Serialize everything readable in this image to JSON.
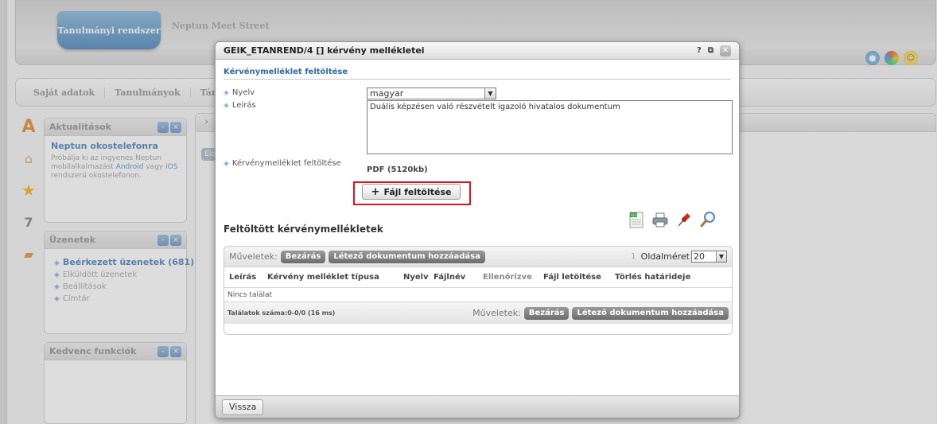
{
  "app": {
    "brand": "Tanulmányi rendszer",
    "subtitle": "Neptun Meet Street",
    "menu": [
      "Saját adatok",
      "Tanulmányok",
      "Tárgy"
    ],
    "panels": {
      "news": {
        "title": "Aktualitások",
        "item_title": "Neptun okostelefonra",
        "text_before": "Próbálja ki az ingyenes Neptun mobilalkalmazást",
        "link_android": "Android",
        "text_mid": "vagy",
        "link_ios": "iOS",
        "text_after": "rendszerű okostelefonon."
      },
      "messages": {
        "title": "Üzenetek",
        "items": [
          "Beérkezett üzenetek (681)",
          "Elküldött üzenetek",
          "Beállítások",
          "Címtár"
        ]
      },
      "favorites": {
        "title": "Kedvenc funkciók"
      }
    },
    "content_button": "Elő"
  },
  "dialog": {
    "title": "GEIK_ETANREND/4 [] kérvény mellékletei",
    "help": "?",
    "section_title": "Kérvénymelléklet feltöltése",
    "language_label": "Nyelv",
    "language_value": "magyar",
    "description_label": "Leírás",
    "description_value": "Duális képzésen való részvételt igazoló hivatalos dokumentum",
    "attachment_label": "Kérvénymelléklet feltöltése",
    "file_type": "PDF (5120kb)",
    "upload_button": "Fájl feltöltése",
    "uploaded_title": "Feltöltött kérvénymellékletek",
    "grid": {
      "ops_label": "Műveletek:",
      "btn_close": "Bezárás",
      "btn_add_existing": "Létező dokumentum hozzáadása",
      "page_number": "1",
      "page_size_label": "Oldalméret",
      "page_size_value": "20",
      "columns": [
        "Leírás",
        "Kérvény melléklet típusa",
        "Nyelv",
        "Fájlnév",
        "Ellenőrizve",
        "Fájl letöltése",
        "Törlés határideje"
      ],
      "empty_text": "Nincs találat",
      "result_count": "Találatok száma:0-0/0 (16 ms)"
    },
    "back_button": "Vissza"
  },
  "colors": {
    "accent_blue": "#2e6aa8",
    "highlight_red": "#e0141a",
    "grid_button": "#7d7d7d"
  }
}
